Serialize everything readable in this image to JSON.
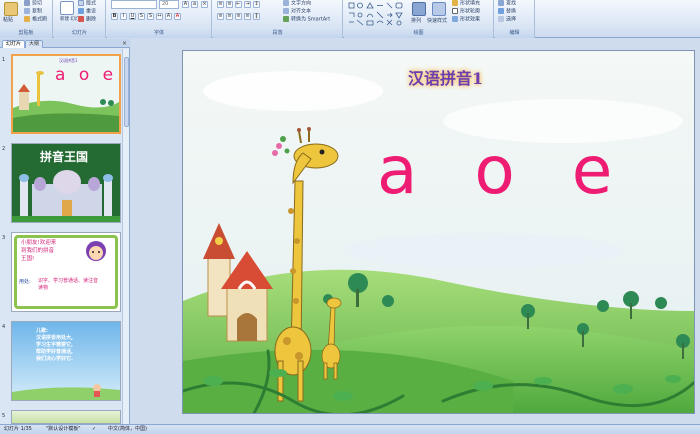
{
  "ribbon": {
    "clipboard": {
      "paste": "粘贴",
      "cut": "剪切",
      "copy": "复制",
      "format_painter": "格式刷",
      "label": "剪贴板"
    },
    "slides": {
      "new_slide": "新建\n幻灯片",
      "layout": "版式",
      "reset": "重设",
      "delete": "删除",
      "label": "幻灯片"
    },
    "font": {
      "font_name": "",
      "font_size": "20",
      "label": "字体"
    },
    "paragraph": {
      "text_direction": "文字方向",
      "align_text": "对齐文本",
      "convert_smartart": "转换为 SmartArt",
      "label": "段落"
    },
    "drawing": {
      "arrange": "排列",
      "quick_styles": "快速样式",
      "shape_fill": "形状填充",
      "shape_outline": "形状轮廓",
      "shape_effects": "形状效果",
      "label": "绘图"
    },
    "editing": {
      "find": "查找",
      "replace": "替换",
      "select": "选择",
      "label": "编辑"
    }
  },
  "panel": {
    "tab_slides": "幻灯片",
    "tab_outline": "大纲",
    "close": "×",
    "thumbs": [
      {
        "num": "1",
        "mini_title": "汉语拼音1",
        "letters": "a o e"
      },
      {
        "num": "2",
        "title": "拼音王国"
      },
      {
        "num": "3",
        "line1": "小朋友!欢迎来",
        "line2": "到我们的拼音",
        "line3": "王国!",
        "use_label": "用处:",
        "use_text": "识字、学习普通话、读注音读物"
      },
      {
        "num": "4",
        "line1": "儿歌:",
        "line2": "汉语拼音用处大,",
        "line3": "学习生字需要它,",
        "line4": "帮助学好普通话,",
        "line5": "我们决心学好它."
      },
      {
        "num": "5"
      }
    ]
  },
  "slide": {
    "title": "汉语拼音1",
    "letters": "a o e"
  },
  "status": {
    "slide_counter": "幻灯片 1/35",
    "theme": "\"默认设计模板\"",
    "language": "中文(简体，中国)"
  },
  "colors": {
    "accent_pink": "#ee1c72",
    "title_purple": "#6a3fb0",
    "ribbon_blue": "#dde8f6"
  }
}
